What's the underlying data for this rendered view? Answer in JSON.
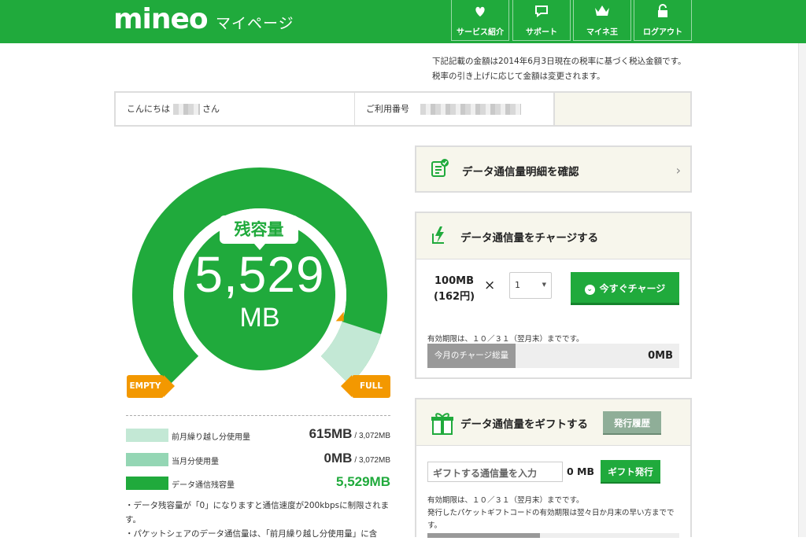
{
  "header": {
    "logo": "mineo",
    "subtitle": "マイページ",
    "nav": [
      {
        "label": "サービス紹介",
        "icon": "heart-leaf-icon"
      },
      {
        "label": "サポート",
        "icon": "speech-bubble-icon"
      },
      {
        "label": "マイネ王",
        "icon": "crown-icon"
      },
      {
        "label": "ログアウト",
        "icon": "lock-icon"
      }
    ]
  },
  "notice": {
    "line1": "下記記載の金額は2014年6月3日現在の税率に基づく税込金額です。",
    "line2": "税率の引き上げに応じて金額は変更されます。"
  },
  "greeting": {
    "prefix": "こんにちは",
    "suffix": "さん",
    "id_label": "ご利用番号"
  },
  "gauge": {
    "label": "残容量",
    "value": "5,529",
    "unit": "MB",
    "empty_label": "EMPTY",
    "full_label": "FULL",
    "capacity_mb": 6144,
    "remaining_mb": 5529
  },
  "legend": [
    {
      "label": "前月繰り越し分使用量",
      "value": "615MB",
      "total": "/ 3,072MB",
      "color": "#c3e8d5"
    },
    {
      "label": "当月分使用量",
      "value": "0MB",
      "total": "/ 3,072MB",
      "color": "#94d6b4"
    },
    {
      "label": "データ通信残容量",
      "value": "5,529MB",
      "total": "",
      "color": "#20aa3c"
    }
  ],
  "notes": {
    "line1": "・データ残容量が「0」になりますと通信速度が200kbpsに制限されます。",
    "line2": "・パケットシェアのデータ通信量は、「前月繰り越し分使用量」に含"
  },
  "panels": {
    "detail": {
      "title": "データ通信量明細を確認"
    },
    "charge": {
      "title": "データ通信量をチャージする",
      "amount_line1": "100MB",
      "amount_line2": "(162円)",
      "times": "×",
      "qty": "1",
      "button": "今すぐチャージ",
      "expire": "有効期限は、１０／３１（翌月末）までです。",
      "total_label": "今月のチャージ総量",
      "total_value": "0MB"
    },
    "gift": {
      "title": "データ通信量をギフトする",
      "history_button": "発行履歴",
      "input_placeholder": "ギフトする通信量を入力",
      "unit": "0 MB",
      "button": "ギフト発行",
      "expire": "有効期限は、１０／３１（翌月末）までです。",
      "note": "発行したパケットギフトコードの有効期限は翌々日か月末の早い方までです。"
    }
  },
  "colors": {
    "brand": "#20aa3c",
    "accent": "#f39800",
    "beige": "#f7f6ec"
  }
}
